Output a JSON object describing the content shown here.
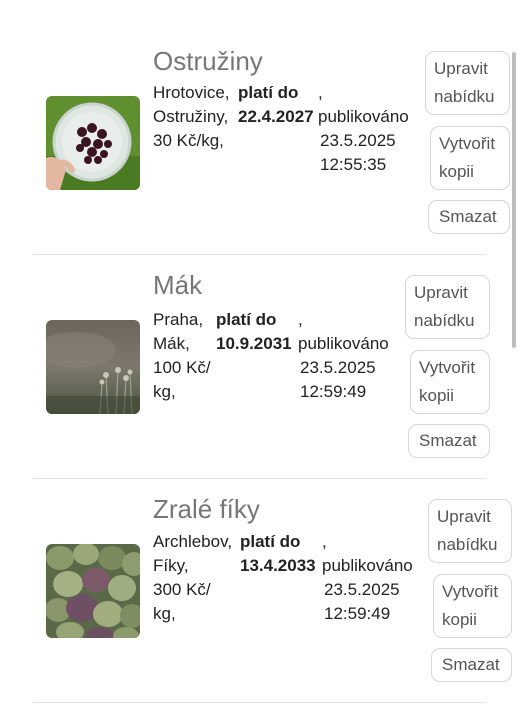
{
  "offers": [
    {
      "title": "Ostružiny",
      "location": "Hrotovice,",
      "product": "Ostružiny,",
      "price_line1": "30 Kč/kg,",
      "price_line2": "",
      "valid_label": "platí do",
      "valid_until": "22.4.2027",
      "published_label": "publikováno",
      "published_date": "23.5.2025",
      "published_time": "12:55:35",
      "edit_line1": "Upravit",
      "edit_line2": "nabídku",
      "copy_line1": "Vytvořit",
      "copy_line2": "kopii",
      "delete_label": "Smazat",
      "image_icon": "berries-in-bowl-photo"
    },
    {
      "title": "Mák",
      "location": "Praha,",
      "product": "Mák,",
      "price_line1": "100 Kč/",
      "price_line2": "kg,",
      "valid_label": "platí do",
      "valid_until": "10.9.2031",
      "published_label": "publikováno",
      "published_date": "23.5.2025",
      "published_time": "12:59:49",
      "edit_line1": "Upravit",
      "edit_line2": "nabídku",
      "copy_line1": "Vytvořit",
      "copy_line2": "kopii",
      "delete_label": "Smazat",
      "image_icon": "poppy-field-photo"
    },
    {
      "title": "Zralé fíky",
      "location": "Archlebov,",
      "product": "Fíky,",
      "price_line1": "300 Kč/",
      "price_line2": "kg,",
      "valid_label": "platí do",
      "valid_until": "13.4.2033",
      "published_label": "publikováno",
      "published_date": "23.5.2025",
      "published_time": "12:59:49",
      "edit_line1": "Upravit",
      "edit_line2": "nabídku",
      "copy_line1": "Vytvořit",
      "copy_line2": "kopii",
      "delete_label": "Smazat",
      "image_icon": "ripe-figs-photo"
    }
  ],
  "separator": ","
}
